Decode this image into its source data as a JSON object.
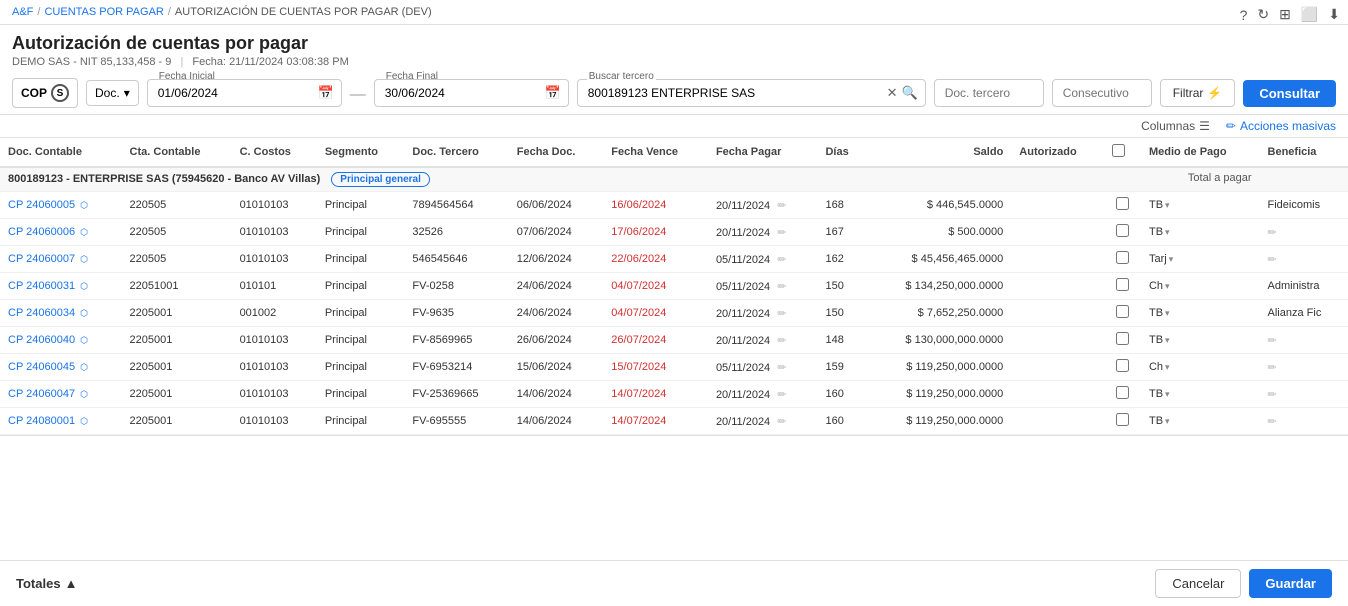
{
  "breadcrumb": {
    "home": "A&F",
    "level1": "CUENTAS POR PAGAR",
    "level2": "AUTORIZACIÓN DE CUENTAS POR PAGAR (DEV)"
  },
  "page": {
    "title": "Autorización de cuentas por pagar",
    "company": "DEMO SAS - NIT 85,133,458 - 9",
    "date_label": "Fecha:",
    "date_value": "21/11/2024 03:08:38 PM"
  },
  "toolbar": {
    "currency": "COP",
    "currency_symbol": "S",
    "doc_type": "Doc.",
    "fecha_inicial_label": "Fecha Inicial",
    "fecha_inicial_value": "01/06/2024",
    "fecha_final_label": "Fecha Final",
    "fecha_final_value": "30/06/2024",
    "buscar_tercero_label": "Buscar tercero",
    "buscar_tercero_value": "800189123 ENTERPRISE SAS",
    "doc_tercero_placeholder": "Doc. tercero",
    "consecutivo_placeholder": "Consecutivo",
    "filtrar_label": "Filtrar",
    "consultar_label": "Consultar"
  },
  "action_bar": {
    "columns_label": "Columnas",
    "acciones_label": "Acciones masivas"
  },
  "table": {
    "headers": [
      "Doc. Contable",
      "Cta. Contable",
      "C. Costos",
      "Segmento",
      "Doc. Tercero",
      "Fecha Doc.",
      "Fecha Vence",
      "Fecha Pagar",
      "Días",
      "Saldo",
      "Autorizado",
      "",
      "Medio de Pago",
      "Beneficia"
    ],
    "group_label": "800189123 - ENTERPRISE SAS (75945620 - Banco AV Villas)",
    "group_badge": "Principal general",
    "total_label": "Total a pagar",
    "rows": [
      {
        "doc": "CP 24060005",
        "cta": "220505",
        "costos": "01010103",
        "segmento": "Principal",
        "doc_tercero": "7894564564",
        "fecha_doc": "06/06/2024",
        "fecha_vence": "16/06/2024",
        "fecha_vence_red": true,
        "fecha_pagar": "20/11/2024",
        "dias": "168",
        "saldo": "$ 446,545.0000",
        "medio_pago": "TB",
        "beneficia": "Fideicomis"
      },
      {
        "doc": "CP 24060006",
        "cta": "220505",
        "costos": "01010103",
        "segmento": "Principal",
        "doc_tercero": "32526",
        "fecha_doc": "07/06/2024",
        "fecha_vence": "17/06/2024",
        "fecha_vence_red": true,
        "fecha_pagar": "20/11/2024",
        "dias": "167",
        "saldo": "$ 500.0000",
        "medio_pago": "TB",
        "beneficia": ""
      },
      {
        "doc": "CP 24060007",
        "cta": "220505",
        "costos": "01010103",
        "segmento": "Principal",
        "doc_tercero": "546545646",
        "fecha_doc": "12/06/2024",
        "fecha_vence": "22/06/2024",
        "fecha_vence_red": true,
        "fecha_pagar": "05/11/2024",
        "dias": "162",
        "saldo": "$ 45,456,465.0000",
        "medio_pago": "Tarj",
        "beneficia": ""
      },
      {
        "doc": "CP 24060031",
        "cta": "22051001",
        "costos": "010101",
        "segmento": "Principal",
        "doc_tercero": "FV-0258",
        "fecha_doc": "24/06/2024",
        "fecha_vence": "04/07/2024",
        "fecha_vence_red": true,
        "fecha_pagar": "05/11/2024",
        "dias": "150",
        "saldo": "$ 134,250,000.0000",
        "medio_pago": "Ch",
        "beneficia": "Administra"
      },
      {
        "doc": "CP 24060034",
        "cta": "2205001",
        "costos": "001002",
        "segmento": "Principal",
        "doc_tercero": "FV-9635",
        "fecha_doc": "24/06/2024",
        "fecha_vence": "04/07/2024",
        "fecha_vence_red": true,
        "fecha_pagar": "20/11/2024",
        "dias": "150",
        "saldo": "$ 7,652,250.0000",
        "medio_pago": "TB",
        "beneficia": "Alianza Fic"
      },
      {
        "doc": "CP 24060040",
        "cta": "2205001",
        "costos": "01010103",
        "segmento": "Principal",
        "doc_tercero": "FV-8569965",
        "fecha_doc": "26/06/2024",
        "fecha_vence": "26/07/2024",
        "fecha_vence_red": true,
        "fecha_pagar": "20/11/2024",
        "dias": "148",
        "saldo": "$ 130,000,000.0000",
        "medio_pago": "TB",
        "beneficia": ""
      },
      {
        "doc": "CP 24060045",
        "cta": "2205001",
        "costos": "01010103",
        "segmento": "Principal",
        "doc_tercero": "FV-6953214",
        "fecha_doc": "15/06/2024",
        "fecha_vence": "15/07/2024",
        "fecha_vence_red": true,
        "fecha_pagar": "05/11/2024",
        "dias": "159",
        "saldo": "$ 119,250,000.0000",
        "medio_pago": "Ch",
        "beneficia": ""
      },
      {
        "doc": "CP 24060047",
        "cta": "2205001",
        "costos": "01010103",
        "segmento": "Principal",
        "doc_tercero": "FV-25369665",
        "fecha_doc": "14/06/2024",
        "fecha_vence": "14/07/2024",
        "fecha_vence_red": true,
        "fecha_pagar": "20/11/2024",
        "dias": "160",
        "saldo": "$ 119,250,000.0000",
        "medio_pago": "TB",
        "beneficia": ""
      },
      {
        "doc": "CP 24080001",
        "cta": "2205001",
        "costos": "01010103",
        "segmento": "Principal",
        "doc_tercero": "FV-695555",
        "fecha_doc": "14/06/2024",
        "fecha_vence": "14/07/2024",
        "fecha_vence_red": true,
        "fecha_pagar": "20/11/2024",
        "dias": "160",
        "saldo": "$ 119,250,000.0000",
        "medio_pago": "TB",
        "beneficia": ""
      }
    ]
  },
  "footer": {
    "totales_label": "Totales",
    "cancel_label": "Cancelar",
    "save_label": "Guardar"
  },
  "top_icons": [
    "question-icon",
    "refresh-icon",
    "layout-icon",
    "window-icon",
    "download-icon"
  ]
}
